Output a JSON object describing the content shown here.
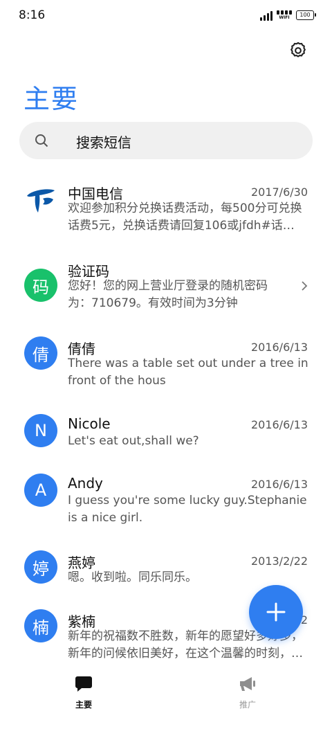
{
  "status_bar": {
    "time": "8:16",
    "wifi_label": "WIFI",
    "battery": "100"
  },
  "header": {
    "title": "主要",
    "settings_icon": "gear-icon"
  },
  "search": {
    "placeholder": "搜索短信",
    "icon": "search-icon"
  },
  "conversations": [
    {
      "name": "中国电信",
      "date": "2017/6/30",
      "preview": "欢迎参加积分兑换话费活动，每500分可兑换话费5元，兑换话费请回复106或jfdh#话…",
      "avatar": "logo"
    },
    {
      "name": "验证码",
      "date": "",
      "preview": "您好！您的网上营业厅登录的随机密码为：710679。有效时间为3分钟",
      "avatar_text": "码"
    },
    {
      "name": "倩倩",
      "date": "2016/6/13",
      "preview": "There was a table set out under a tree in front of the hous",
      "avatar_text": "倩"
    },
    {
      "name": "Nicole",
      "date": "2016/6/13",
      "preview": "Let's eat out,shall we?",
      "avatar_text": "N"
    },
    {
      "name": "Andy",
      "date": "2016/6/13",
      "preview": "I guess you're some lucky guy.Stephanie is a nice girl.",
      "avatar_text": "A"
    },
    {
      "name": "燕婷",
      "date": "2013/2/22",
      "preview": "嗯。收到啦。同乐同乐。",
      "avatar_text": "婷"
    },
    {
      "name": "紫楠",
      "date": "2",
      "preview": "新年的祝福数不胜数，新年的愿望好多好多，新年的问候依旧美好，在这个温馨的时刻，…",
      "avatar_text": "楠"
    }
  ],
  "bottom_nav": [
    {
      "label": "主要",
      "icon": "chat-bubble-icon",
      "active": true
    },
    {
      "label": "推广",
      "icon": "megaphone-icon",
      "active": false
    }
  ],
  "colors": {
    "accent": "#2f7ef0",
    "green": "#19c16b"
  }
}
